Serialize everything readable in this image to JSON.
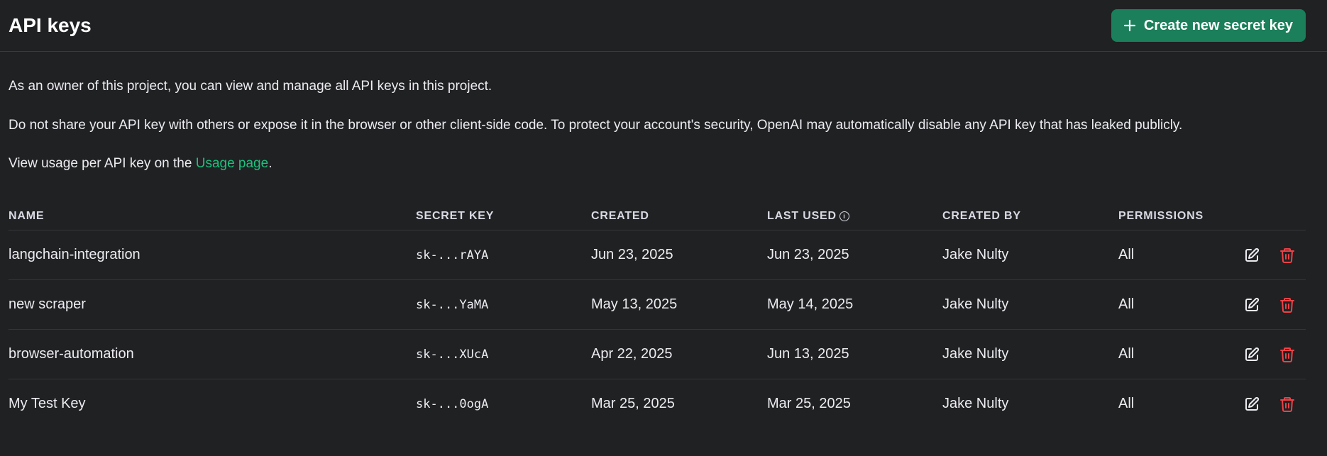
{
  "header": {
    "title": "API keys",
    "create_button_label": "Create new secret key"
  },
  "description": {
    "line1": "As an owner of this project, you can view and manage all API keys in this project.",
    "line2": "Do not share your API key with others or expose it in the browser or other client-side code. To protect your account's security, OpenAI may automatically disable any API key that has leaked publicly.",
    "line3_prefix": "View usage per API key on the ",
    "line3_link": "Usage page",
    "line3_suffix": "."
  },
  "table": {
    "columns": {
      "name": "NAME",
      "secret_key": "SECRET KEY",
      "created": "CREATED",
      "last_used": "LAST USED",
      "created_by": "CREATED BY",
      "permissions": "PERMISSIONS"
    },
    "rows": [
      {
        "name": "langchain-integration",
        "secret_key": "sk-...rAYA",
        "created": "Jun 23, 2025",
        "last_used": "Jun 23, 2025",
        "created_by": "Jake Nulty",
        "permissions": "All"
      },
      {
        "name": "new scraper",
        "secret_key": "sk-...YaMA",
        "created": "May 13, 2025",
        "last_used": "May 14, 2025",
        "created_by": "Jake Nulty",
        "permissions": "All"
      },
      {
        "name": "browser-automation",
        "secret_key": "sk-...XUcA",
        "created": "Apr 22, 2025",
        "last_used": "Jun 13, 2025",
        "created_by": "Jake Nulty",
        "permissions": "All"
      },
      {
        "name": "My Test Key",
        "secret_key": "sk-...0ogA",
        "created": "Mar 25, 2025",
        "last_used": "Mar 25, 2025",
        "created_by": "Jake Nulty",
        "permissions": "All"
      }
    ]
  },
  "icons": {
    "plus": "plus-icon",
    "info": "info-icon",
    "edit": "edit-icon",
    "delete": "trash-icon"
  },
  "colors": {
    "accent": "#1a7f5a",
    "link": "#19c37d",
    "danger": "#ef4146",
    "background": "#202123"
  }
}
